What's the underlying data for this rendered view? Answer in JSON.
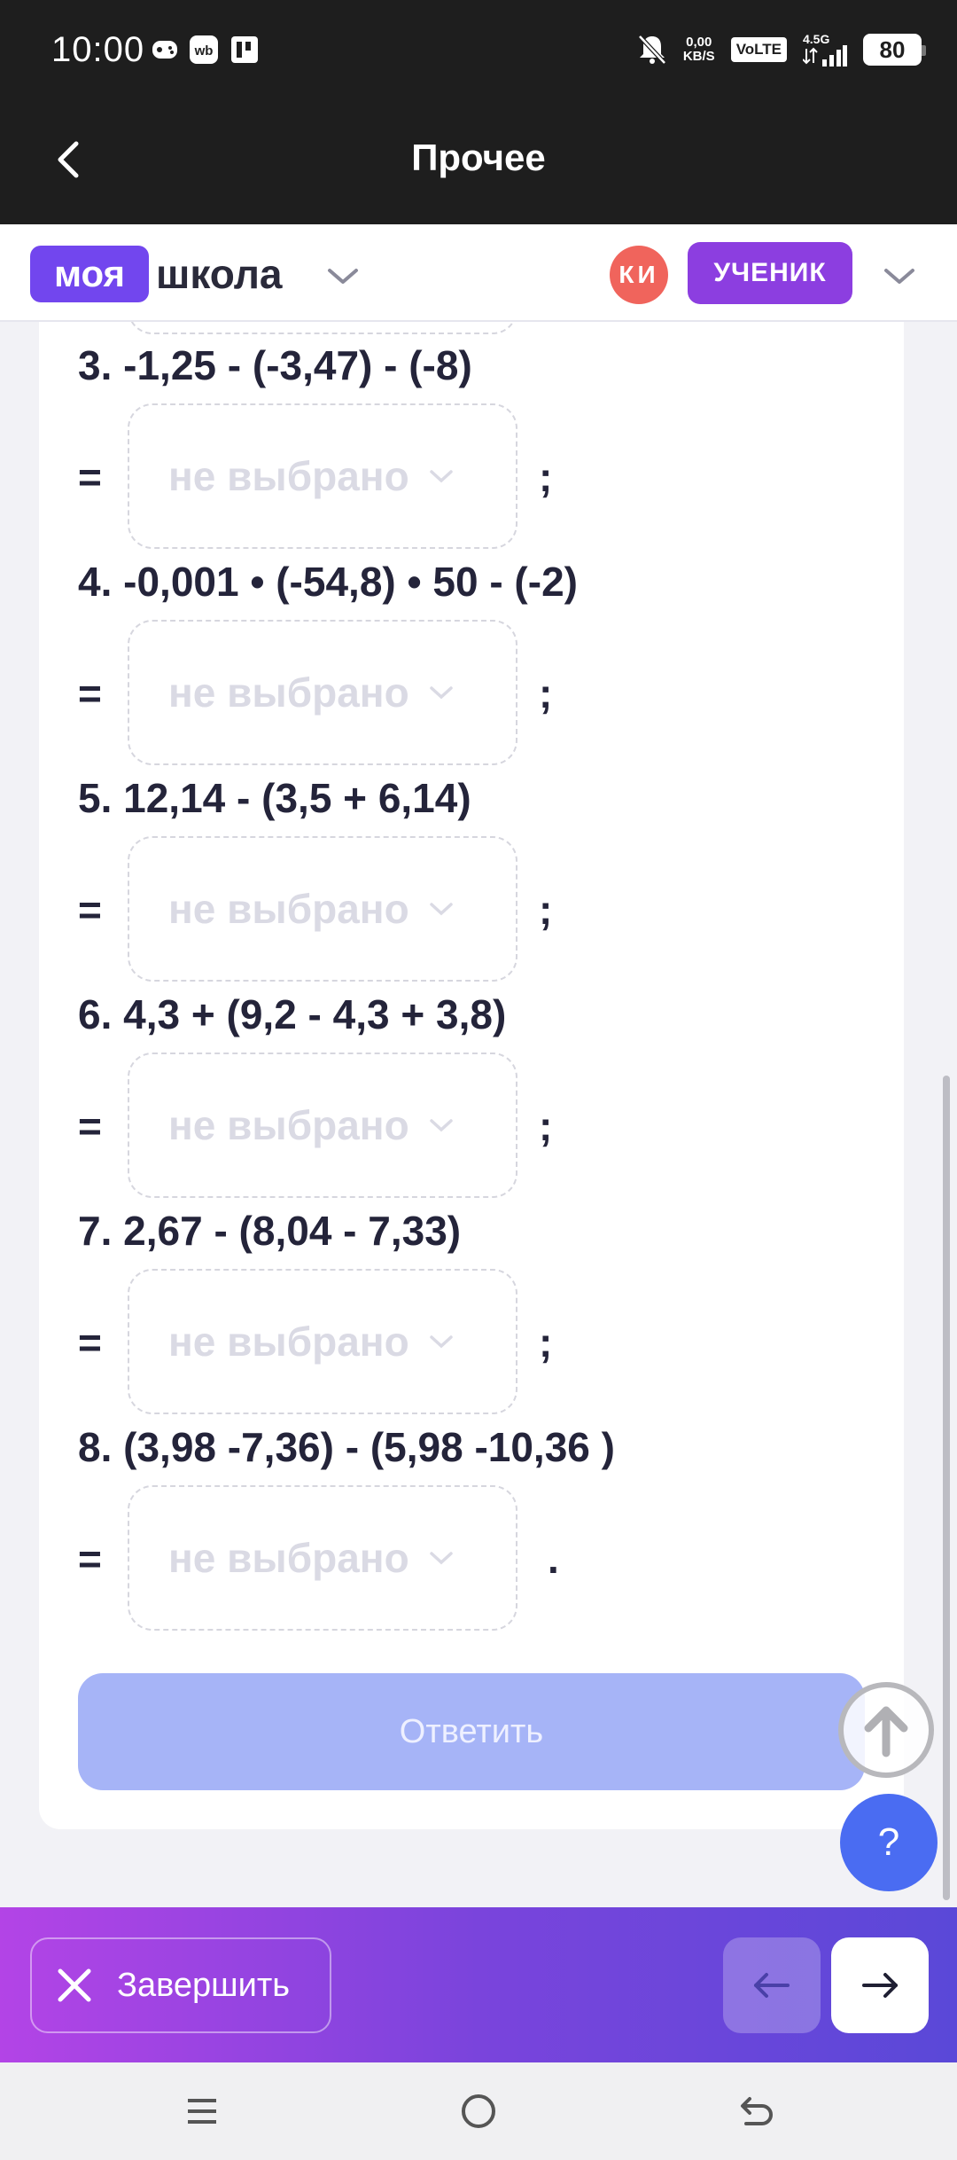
{
  "status_bar": {
    "time": "10:00",
    "speed_value": "0,00",
    "speed_unit": "KB/S",
    "volte": "VoLTE",
    "network": "4.5G",
    "battery": "80",
    "icons": [
      "game-icon",
      "wb-app-icon",
      "p-app-icon",
      "mute-icon",
      "signal-icon",
      "battery-icon"
    ]
  },
  "title_bar": {
    "title": "Прочее"
  },
  "app_header": {
    "logo_part1": "моя",
    "logo_part2": "школа",
    "avatar_initials": "КИ",
    "role": "УЧЕНИК"
  },
  "exercises": [
    {
      "expression": "3. -1,25 - (-3,47) - (-8)",
      "eq": "=",
      "placeholder": "не выбрано",
      "punct": ";"
    },
    {
      "expression": "4. -0,001 • (-54,8) • 50 - (-2)",
      "eq": "=",
      "placeholder": "не выбрано",
      "punct": ";"
    },
    {
      "expression": "5. 12,14 - (3,5 + 6,14)",
      "eq": "=",
      "placeholder": "не выбрано",
      "punct": ";"
    },
    {
      "expression": "6. 4,3 + (9,2 - 4,3 + 3,8)",
      "eq": "=",
      "placeholder": "не выбрано",
      "punct": ";"
    },
    {
      "expression": "7. 2,67 - (8,04 - 7,33)",
      "eq": "=",
      "placeholder": "не выбрано",
      "punct": ";"
    },
    {
      "expression": "8. (3,98 -7,36) - (5,98 -10,36 )",
      "eq": "=",
      "placeholder": "не выбрано",
      "punct": "."
    }
  ],
  "actions": {
    "answer_label": "Ответить",
    "help_label": "?"
  },
  "bottom_bar": {
    "finish_label": "Завершить"
  },
  "colors": {
    "brand_purple": "#7246ee",
    "role_purple": "#8c3ee0",
    "avatar_red": "#f0645c",
    "answer_disabled": "#a6b4f7",
    "help_blue": "#4a6cf2"
  }
}
